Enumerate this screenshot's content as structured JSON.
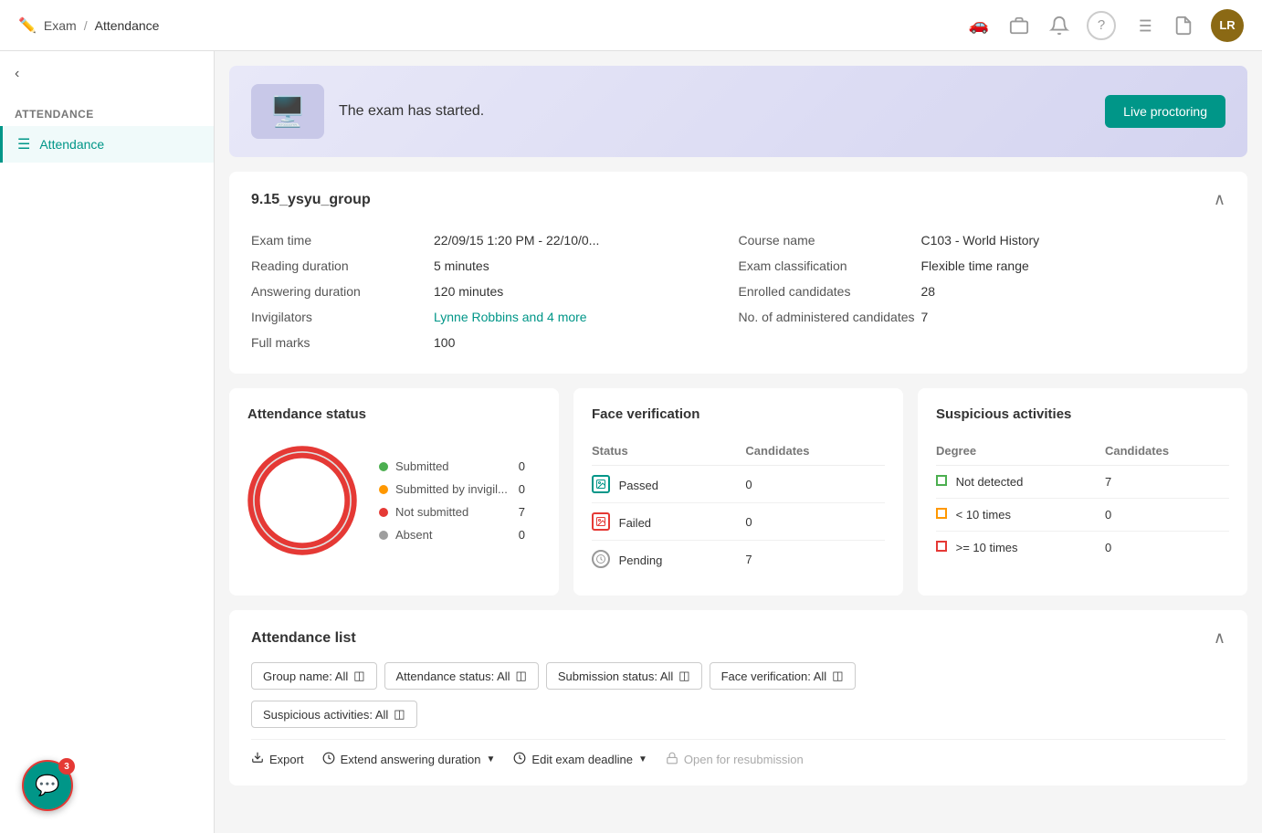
{
  "topNav": {
    "breadcrumb_exam": "Exam",
    "breadcrumb_separator": "/",
    "breadcrumb_current": "Attendance",
    "nav_icons": [
      "bell",
      "briefcase",
      "question",
      "list",
      "document"
    ],
    "avatar_initials": "LR"
  },
  "sidebar": {
    "toggle_label": "<",
    "section_title": "Attendance",
    "items": [
      {
        "label": "Attendance",
        "icon": "≡",
        "active": true
      }
    ]
  },
  "banner": {
    "text": "The exam has started.",
    "live_proctoring_label": "Live proctoring"
  },
  "examCard": {
    "title": "9.15_ysyu_group",
    "fields_left": [
      {
        "label": "Exam time",
        "value": "22/09/15 1:20 PM - 22/10/0..."
      },
      {
        "label": "Reading duration",
        "value": "5 minutes"
      },
      {
        "label": "Answering duration",
        "value": "120 minutes"
      },
      {
        "label": "Invigilators",
        "value": "Lynne Robbins and 4 more",
        "link": true
      },
      {
        "label": "Full marks",
        "value": "100"
      }
    ],
    "fields_right": [
      {
        "label": "Course name",
        "value": "C103 - World History"
      },
      {
        "label": "Exam classification",
        "value": "Flexible time range"
      },
      {
        "label": "Enrolled candidates",
        "value": "28"
      },
      {
        "label": "No. of administered candidates",
        "value": "7"
      }
    ]
  },
  "attendanceStatus": {
    "title": "Attendance status",
    "legend": [
      {
        "label": "Submitted",
        "count": 0,
        "color": "#4caf50"
      },
      {
        "label": "Submitted by invigil...",
        "count": 0,
        "color": "#ff9800"
      },
      {
        "label": "Not submitted",
        "count": 7,
        "color": "#e53935"
      },
      {
        "label": "Absent",
        "count": 0,
        "color": "#9e9e9e"
      }
    ],
    "donut": {
      "total": 7,
      "segments": [
        {
          "value": 7,
          "color": "#e53935"
        }
      ]
    }
  },
  "faceVerification": {
    "title": "Face verification",
    "col_status": "Status",
    "col_candidates": "Candidates",
    "rows": [
      {
        "status": "Passed",
        "type": "passed",
        "candidates": 0
      },
      {
        "status": "Failed",
        "type": "failed",
        "candidates": 0
      },
      {
        "status": "Pending",
        "type": "pending",
        "candidates": 7
      }
    ]
  },
  "suspiciousActivities": {
    "title": "Suspicious activities",
    "col_degree": "Degree",
    "col_candidates": "Candidates",
    "rows": [
      {
        "label": "Not detected",
        "type": "green",
        "candidates": 7
      },
      {
        "label": "< 10 times",
        "type": "orange",
        "candidates": 0
      },
      {
        "label": ">= 10 times",
        "type": "red",
        "candidates": 0
      }
    ]
  },
  "attendanceList": {
    "title": "Attendance list",
    "filters": [
      {
        "label": "Group name: All"
      },
      {
        "label": "Attendance status: All"
      },
      {
        "label": "Submission status: All"
      },
      {
        "label": "Face verification: All"
      },
      {
        "label": "Suspicious activities: All"
      }
    ],
    "actions": [
      {
        "label": "Export",
        "icon": "export",
        "disabled": false,
        "has_chevron": false
      },
      {
        "label": "Extend answering duration",
        "icon": "clock",
        "disabled": false,
        "has_chevron": true
      },
      {
        "label": "Edit exam deadline",
        "icon": "clock",
        "disabled": false,
        "has_chevron": true
      },
      {
        "label": "Open for resubmission",
        "icon": "lock",
        "disabled": true,
        "has_chevron": false
      }
    ]
  },
  "chat": {
    "badge_count": "3"
  }
}
